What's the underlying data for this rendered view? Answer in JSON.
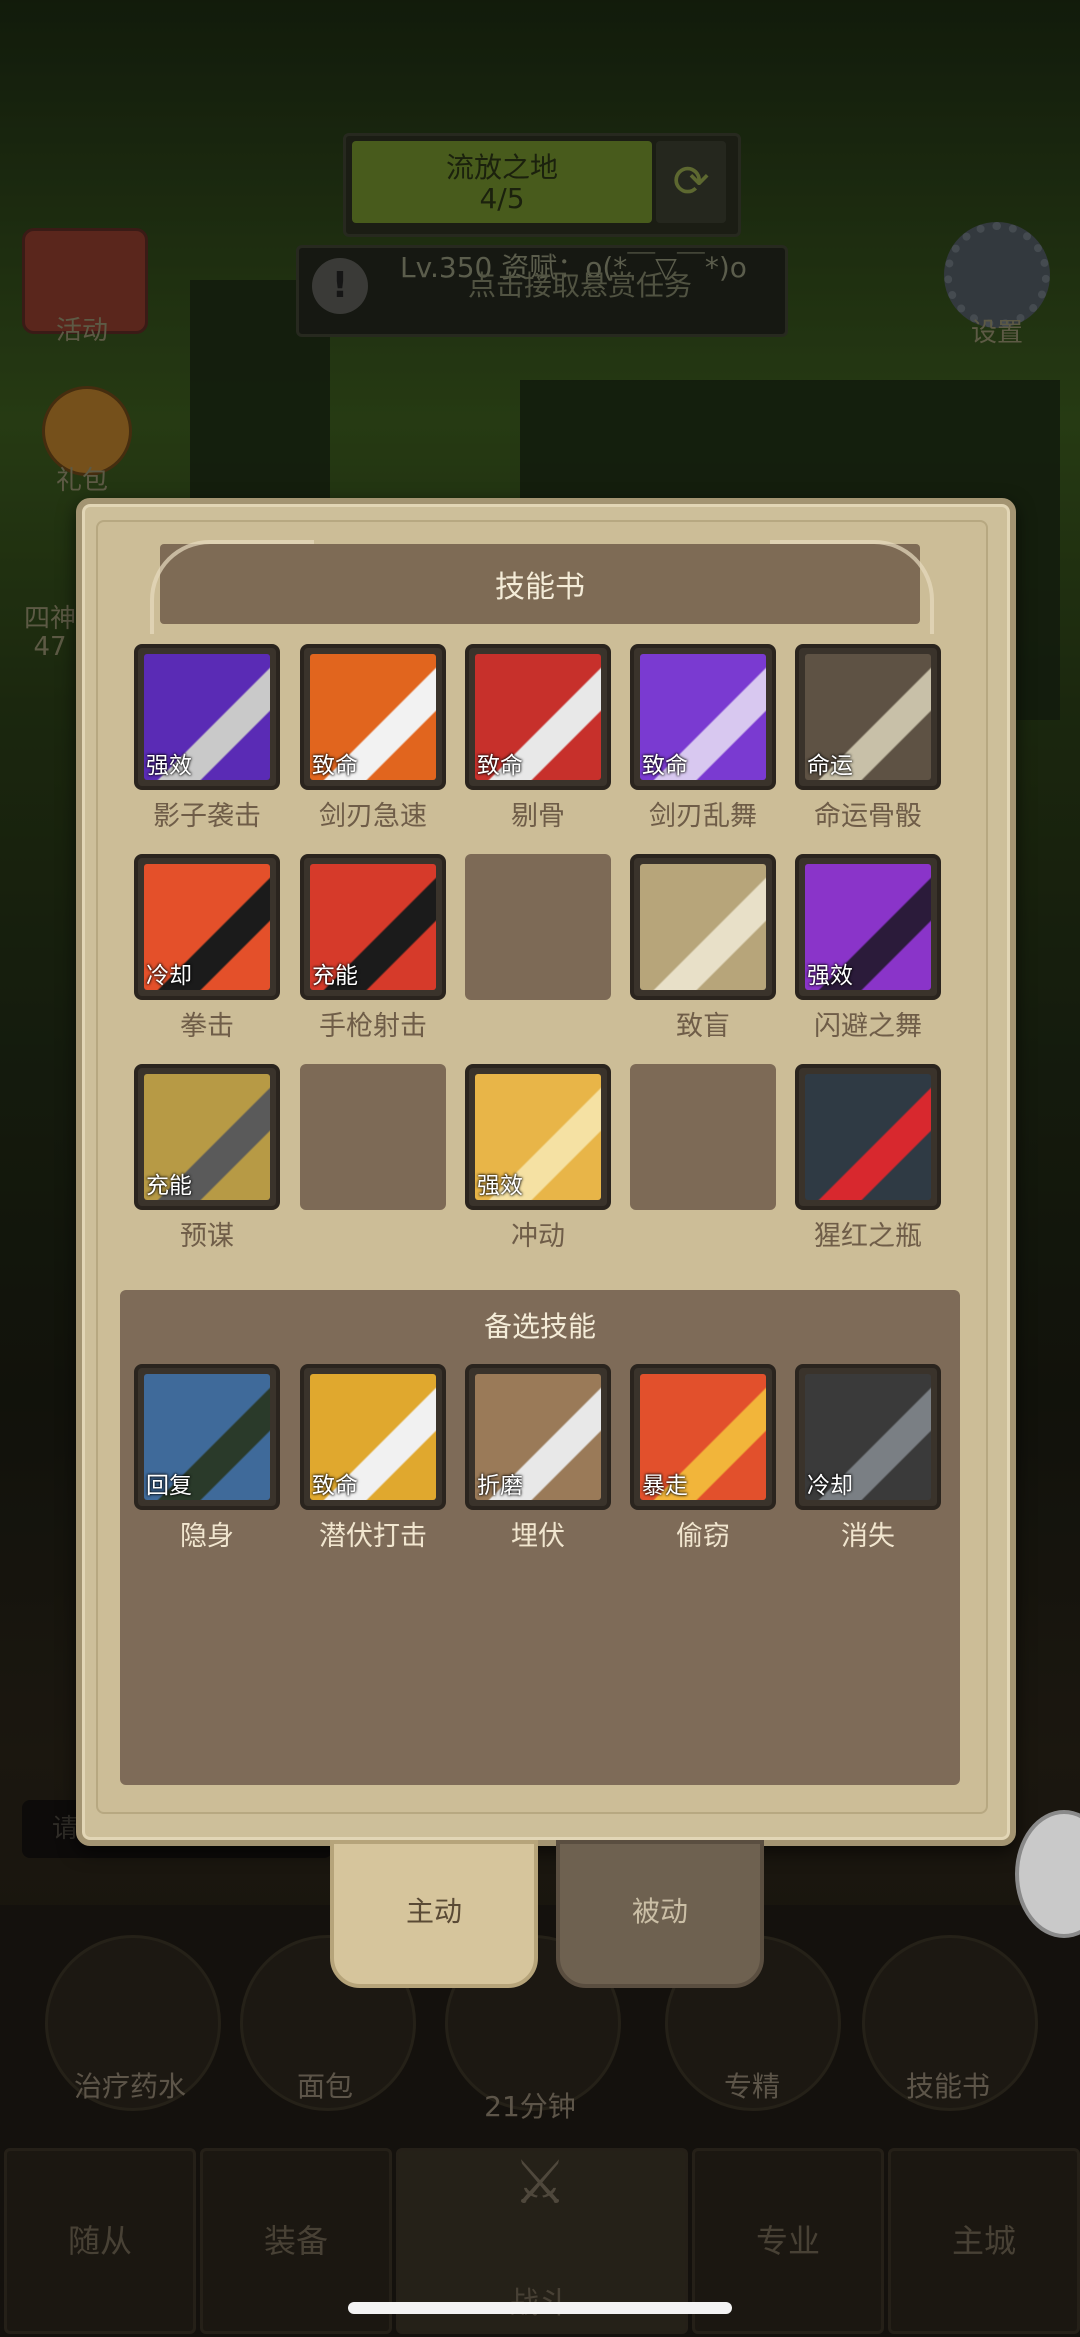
{
  "top": {
    "zone_name": "流放之地",
    "zone_progress": "4/5",
    "level_info": "Lv.350 资赋：o(*￣▽￣*)o",
    "quest_text": "点击接取悬赏任务",
    "left_buttons": [
      "活动",
      "礼包",
      "四神"
    ],
    "left_partial": "47",
    "settings_label": "设置"
  },
  "panel": {
    "title": "技能书",
    "rows": [
      [
        {
          "name": "影子袭击",
          "tag": "强效",
          "icon": "shadow-strike-icon",
          "colors": [
            "#5a2bb5",
            "#c9c9c9"
          ]
        },
        {
          "name": "剑刃急速",
          "tag": "致命",
          "icon": "blade-rush-icon",
          "colors": [
            "#e1651e",
            "#f2f2f2"
          ]
        },
        {
          "name": "剔骨",
          "tag": "致命",
          "icon": "bone-cut-icon",
          "colors": [
            "#c7302b",
            "#e8e8e8"
          ]
        },
        {
          "name": "剑刃乱舞",
          "tag": "致命",
          "icon": "blade-dance-icon",
          "colors": [
            "#7a3ad1",
            "#d8c8f0"
          ]
        },
        {
          "name": "命运骨骰",
          "tag": "命运",
          "icon": "fate-dice-icon",
          "colors": [
            "#5e5244",
            "#c8c0a8"
          ]
        }
      ],
      [
        {
          "name": "拳击",
          "tag": "冷却",
          "icon": "punch-icon",
          "colors": [
            "#e4502a",
            "#1b1b1b"
          ]
        },
        {
          "name": "手枪射击",
          "tag": "充能",
          "icon": "pistol-shot-icon",
          "colors": [
            "#d63a2a",
            "#1b1b1b"
          ]
        },
        {
          "name": "",
          "tag": "",
          "icon": "",
          "colors": []
        },
        {
          "name": "致盲",
          "tag": "",
          "icon": "blind-icon",
          "colors": [
            "#b7a57a",
            "#e8e0c8"
          ]
        },
        {
          "name": "闪避之舞",
          "tag": "强效",
          "icon": "dodge-dance-icon",
          "colors": [
            "#8a34c9",
            "#2b1b3a"
          ]
        }
      ],
      [
        {
          "name": "预谋",
          "tag": "充能",
          "icon": "premeditate-icon",
          "colors": [
            "#b79a45",
            "#5a5a5a"
          ]
        },
        {
          "name": "",
          "tag": "",
          "icon": "",
          "colors": []
        },
        {
          "name": "冲动",
          "tag": "强效",
          "icon": "impulse-icon",
          "colors": [
            "#e8b548",
            "#f5e1a3"
          ]
        },
        {
          "name": "",
          "tag": "",
          "icon": "",
          "colors": []
        },
        {
          "name": "猩红之瓶",
          "tag": "",
          "icon": "crimson-flask-icon",
          "colors": [
            "#2f3a44",
            "#d8282e"
          ]
        }
      ]
    ],
    "alt_title": "备选技能",
    "alt_skills": [
      {
        "name": "隐身",
        "tag": "回复",
        "icon": "stealth-icon",
        "colors": [
          "#3f6a9a",
          "#2a3a2a"
        ]
      },
      {
        "name": "潜伏打击",
        "tag": "致命",
        "icon": "ambush-strike-icon",
        "colors": [
          "#e0a82e",
          "#f1f1f1"
        ]
      },
      {
        "name": "埋伏",
        "tag": "折磨",
        "icon": "ambush-icon",
        "colors": [
          "#9a7a58",
          "#e8e8e8"
        ]
      },
      {
        "name": "偷窃",
        "tag": "暴走",
        "icon": "steal-icon",
        "colors": [
          "#e2502c",
          "#f2b53a"
        ]
      },
      {
        "name": "消失",
        "tag": "冷却",
        "icon": "vanish-icon",
        "colors": [
          "#3a3a3a",
          "#7a7f84"
        ]
      }
    ]
  },
  "tabs": {
    "active": "主动",
    "passive": "被动"
  },
  "input_placeholder": "请输入你的内容",
  "hud": {
    "consumables": [
      {
        "label": "治疗药水",
        "icon": "potion-icon"
      },
      {
        "label": "面包",
        "icon": "bread-icon"
      },
      {
        "label": "21分钟",
        "icon": "treasure-chest-icon"
      },
      {
        "label": "专精",
        "icon": "mastery-icon"
      },
      {
        "label": "技能书",
        "icon": "skill-book-icon"
      }
    ],
    "nav": [
      "随从",
      "装备",
      "战斗",
      "专业",
      "主城"
    ]
  }
}
